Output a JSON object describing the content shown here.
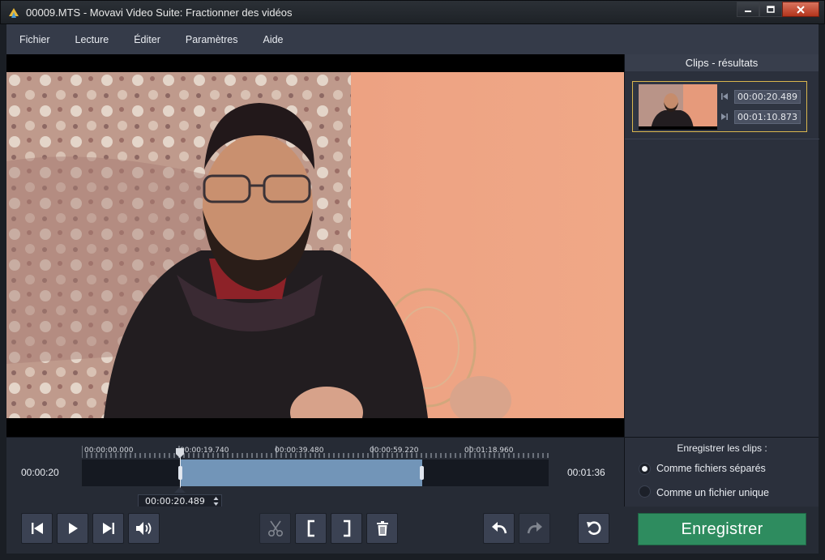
{
  "window": {
    "title": "00009.MTS - Movavi Video Suite: Fractionner des vidéos"
  },
  "menu": {
    "items": [
      "Fichier",
      "Lecture",
      "Éditer",
      "Paramètres",
      "Aide"
    ]
  },
  "clips_panel": {
    "header": "Clips - résultats",
    "clips": [
      {
        "start": "00:00:20.489",
        "end": "00:01:10.873"
      }
    ]
  },
  "timeline": {
    "current_time": "00:00:20",
    "total_time": "00:01:36",
    "ruler_labels": [
      "00:00:00.000",
      "00:00:19.740",
      "00:00:39.480",
      "00:00:59.220",
      "00:01:18.960"
    ],
    "position_field": "00:00:20.489",
    "selection_start_fraction": 0.21,
    "selection_end_fraction": 0.73,
    "playhead_fraction": 0.21
  },
  "save_options": {
    "title": "Enregistrer les clips :",
    "options": [
      {
        "label": "Comme fichiers séparés",
        "selected": true
      },
      {
        "label": "Comme un fichier unique",
        "selected": false
      }
    ]
  },
  "toolbar": {
    "save_label": "Enregistrer",
    "accent_color": "#2e8c5f",
    "selection_color": "#7295b8",
    "icons": [
      "skip-back-icon",
      "play-icon",
      "skip-forward-icon",
      "volume-icon",
      "scissors-icon",
      "bracket-left-icon",
      "bracket-right-icon",
      "trash-icon",
      "undo-icon",
      "redo-icon",
      "reset-icon"
    ]
  }
}
